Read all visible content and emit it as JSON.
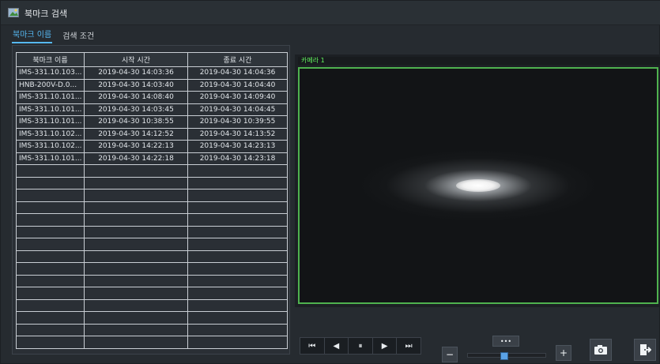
{
  "window": {
    "title": "북마크 검색",
    "icon": "bookmark-window-icon"
  },
  "tabs": [
    {
      "label": "북마크 이름",
      "active": true
    },
    {
      "label": "검색 조건",
      "active": false
    }
  ],
  "table": {
    "columns": [
      "북마크 이름",
      "시작 시간",
      "종료 시간"
    ],
    "rows": [
      [
        "IMS-331.10.103...",
        "2019-04-30 14:03:36",
        "2019-04-30 14:04:36"
      ],
      [
        "HNB-200V-D.0...",
        "2019-04-30 14:03:40",
        "2019-04-30 14:04:40"
      ],
      [
        "IMS-331.10.101...",
        "2019-04-30 14:08:40",
        "2019-04-30 14:09:40"
      ],
      [
        "IMS-331.10.101...",
        "2019-04-30 14:03:45",
        "2019-04-30 14:04:45"
      ],
      [
        "IMS-331.10.101...",
        "2019-04-30 10:38:55",
        "2019-04-30 10:39:55"
      ],
      [
        "IMS-331.10.102...",
        "2019-04-30 14:12:52",
        "2019-04-30 14:13:52"
      ],
      [
        "IMS-331.10.102...",
        "2019-04-30 14:22:13",
        "2019-04-30 14:23:13"
      ],
      [
        "IMS-331.10.101...",
        "2019-04-30 14:22:18",
        "2019-04-30 14:23:18"
      ]
    ],
    "empty_rows": 15
  },
  "video": {
    "camera_label": "카메라 1",
    "border_color": "#4fb24f"
  },
  "playback": {
    "buttons": [
      {
        "name": "skip-to-start-button",
        "icon": "skip-back-icon",
        "glyph": "⏮"
      },
      {
        "name": "step-back-button",
        "icon": "step-back-icon",
        "glyph": "◀"
      },
      {
        "name": "pause-button",
        "icon": "pause-icon",
        "glyph": "⏸"
      },
      {
        "name": "play-button",
        "icon": "play-icon",
        "glyph": "▶"
      },
      {
        "name": "skip-to-end-button",
        "icon": "skip-forward-icon",
        "glyph": "⏭"
      }
    ],
    "speed_label": "•••",
    "zoom_minus": "−",
    "zoom_plus": "+",
    "slider_value": 0.45
  },
  "actions": {
    "snapshot_icon": "camera-icon",
    "exit_icon": "exit-door-icon"
  }
}
